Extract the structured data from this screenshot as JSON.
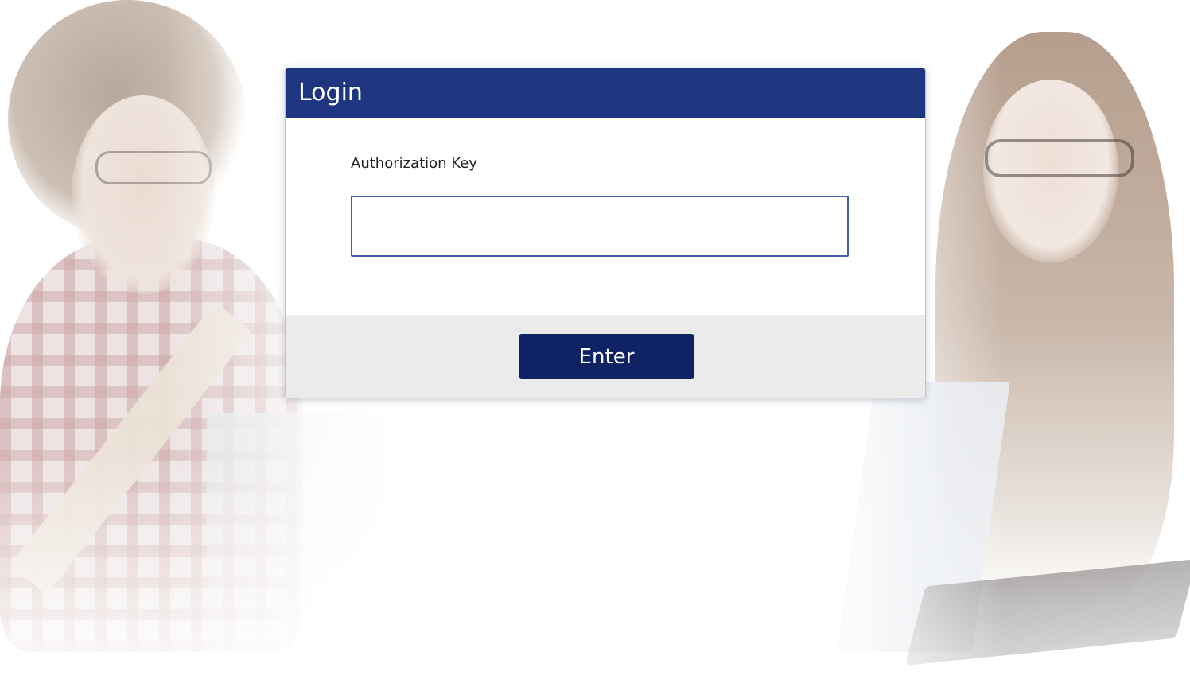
{
  "login": {
    "title": "Login",
    "field_label": "Authorization Key",
    "input_value": "",
    "enter_label": "Enter"
  },
  "colors": {
    "header": "#1e3580",
    "button": "#0f2263",
    "footer": "#ecebec",
    "input_border": "#3f5fa8"
  }
}
